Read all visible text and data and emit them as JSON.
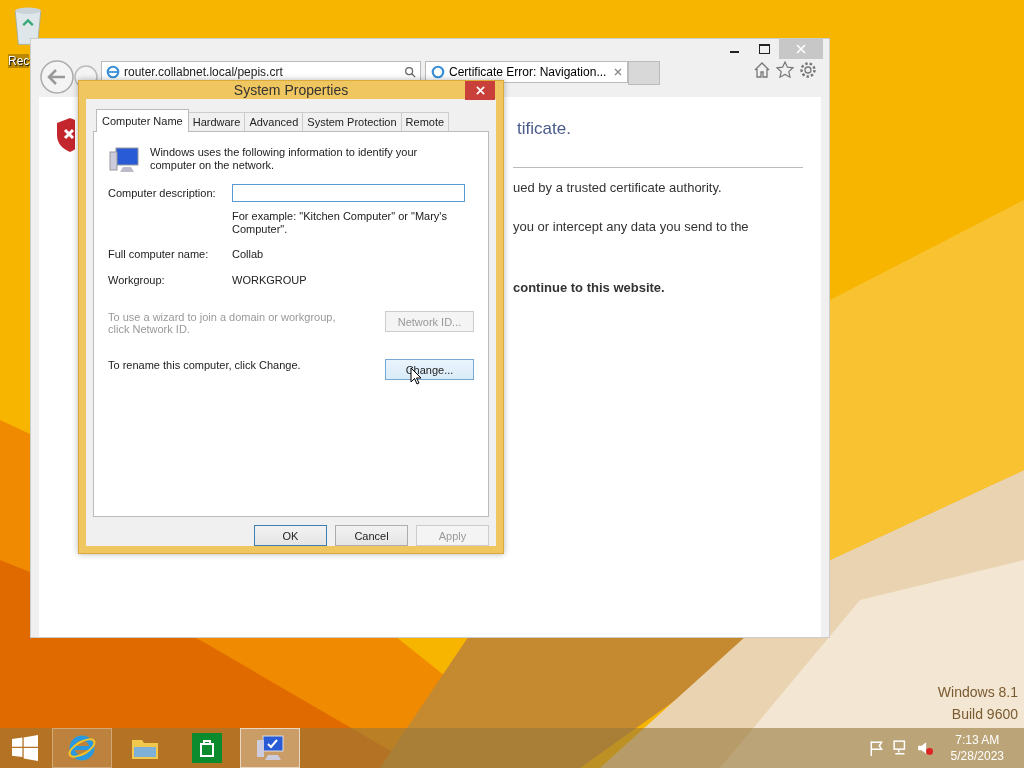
{
  "desktop": {
    "icons": [
      {
        "label": "Rec"
      }
    ],
    "watermark": [
      "Windows 8.1",
      "Build 9600"
    ]
  },
  "browser": {
    "address": "router.collabnet.local/pepis.crt",
    "tabs": [
      {
        "title": "Certificate Error: Navigation...",
        "selected": true
      }
    ],
    "page": {
      "heading": "tificate.",
      "lines": [
        "ued by a trusted certificate authority.",
        "you or intercept any data you send to the"
      ],
      "bold_line": "continue to this website."
    }
  },
  "dialog": {
    "title": "System Properties",
    "tabs": [
      {
        "label": "Computer Name",
        "selected": true
      },
      {
        "label": "Hardware",
        "selected": false
      },
      {
        "label": "Advanced",
        "selected": false
      },
      {
        "label": "System Protection",
        "selected": false
      },
      {
        "label": "Remote",
        "selected": false
      }
    ],
    "intro": "Windows uses the following information to identify your computer on the network.",
    "description_label": "Computer description:",
    "description_hint": "For example: \"Kitchen Computer\" or \"Mary's Computer\".",
    "rows": [
      {
        "label": "Full computer name:",
        "value": "Collab"
      },
      {
        "label": "Workgroup:",
        "value": "WORKGROUP"
      }
    ],
    "actions": [
      {
        "text": "To use a wizard to join a domain or workgroup, click Network ID.",
        "button": "Network ID...",
        "disabled": true
      },
      {
        "text": "To rename this computer, click Change.",
        "button": "Change...",
        "disabled": false
      }
    ],
    "buttons": [
      {
        "label": "OK",
        "default": true,
        "disabled": false
      },
      {
        "label": "Cancel",
        "default": false,
        "disabled": false
      },
      {
        "label": "Apply",
        "default": false,
        "disabled": true
      }
    ]
  },
  "taskbar": {
    "apps": [
      {
        "kind": "browser",
        "selected": false
      },
      {
        "kind": "folder",
        "selected": false
      },
      {
        "kind": "store",
        "selected": false
      },
      {
        "kind": "system",
        "selected": true
      }
    ],
    "time": "7:13 AM",
    "date": "5/28/2023"
  }
}
